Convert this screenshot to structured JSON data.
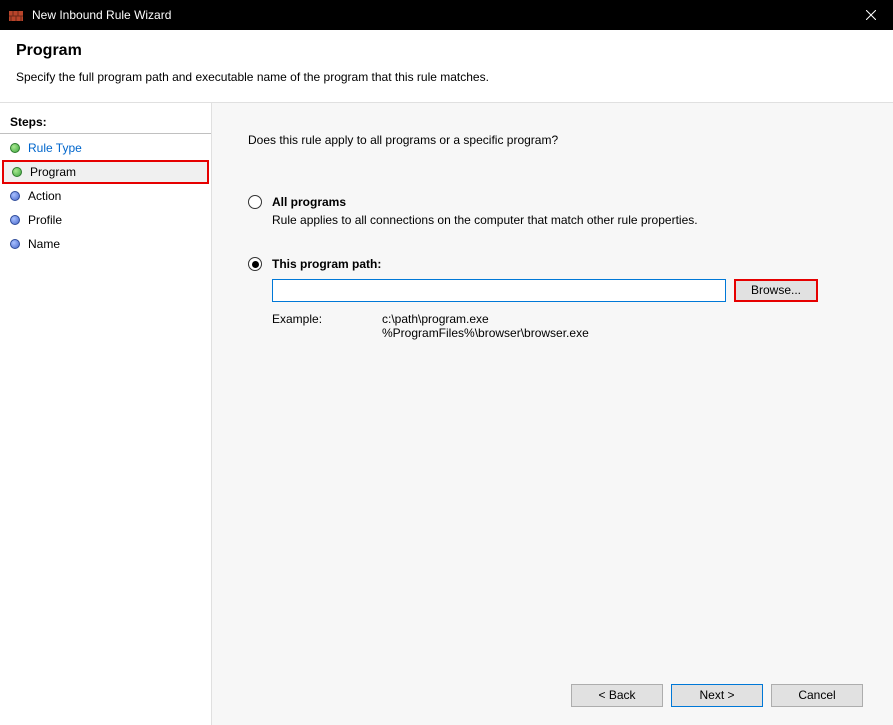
{
  "titlebar": {
    "title": "New Inbound Rule Wizard"
  },
  "header": {
    "title": "Program",
    "subtitle": "Specify the full program path and executable name of the program that this rule matches."
  },
  "sidebar": {
    "steps_label": "Steps:",
    "items": [
      {
        "label": "Rule Type",
        "state": "done"
      },
      {
        "label": "Program",
        "state": "current"
      },
      {
        "label": "Action",
        "state": "future"
      },
      {
        "label": "Profile",
        "state": "future"
      },
      {
        "label": "Name",
        "state": "future"
      }
    ]
  },
  "main": {
    "question": "Does this rule apply to all programs or a specific program?",
    "options": {
      "all": {
        "label": "All programs",
        "desc": "Rule applies to all connections on the computer that match other rule properties."
      },
      "path": {
        "label": "This program path:",
        "input_value": "",
        "browse_label": "Browse...",
        "example_label": "Example:",
        "example_text": "c:\\path\\program.exe\n%ProgramFiles%\\browser\\browser.exe"
      }
    },
    "selected_option": "path"
  },
  "footer": {
    "back": "< Back",
    "next": "Next >",
    "cancel": "Cancel"
  }
}
